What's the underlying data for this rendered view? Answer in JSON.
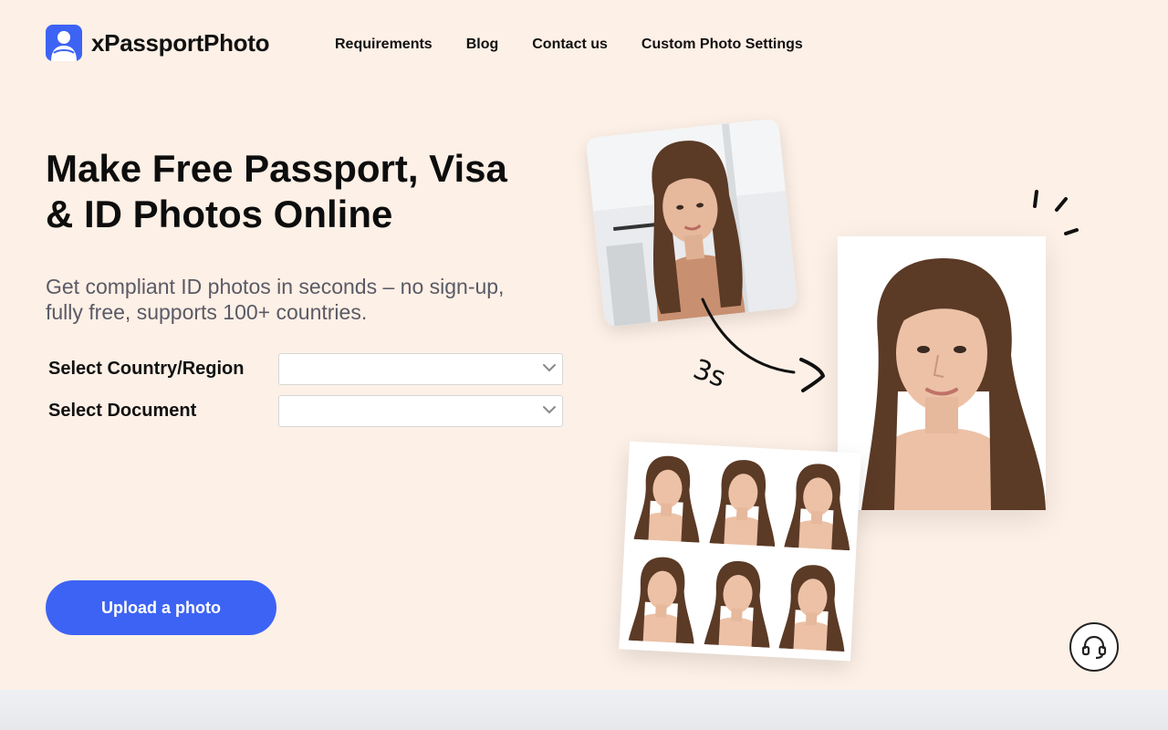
{
  "brand": {
    "name": "xPassportPhoto",
    "accent": "#3d63f5",
    "background": "#fdf0e6"
  },
  "nav": {
    "items": [
      {
        "label": "Requirements"
      },
      {
        "label": "Blog"
      },
      {
        "label": "Contact us"
      },
      {
        "label": "Custom Photo Settings"
      }
    ]
  },
  "hero": {
    "title_line1": "Make Free Passport, Visa",
    "title_line2": "& ID Photos Online",
    "subtitle_line1": "Get compliant ID photos in seconds – no sign-up,",
    "subtitle_line2": "fully free, supports 100+ countries."
  },
  "form": {
    "country": {
      "label": "Select Country/Region",
      "value": ""
    },
    "document": {
      "label": "Select Document",
      "value": ""
    }
  },
  "upload": {
    "label": "Upload a photo"
  },
  "illustration": {
    "timer_text": "3s"
  },
  "icons": {
    "logo": "person-avatar-icon",
    "chevron": "chevron-down-icon",
    "support": "headset-icon"
  }
}
